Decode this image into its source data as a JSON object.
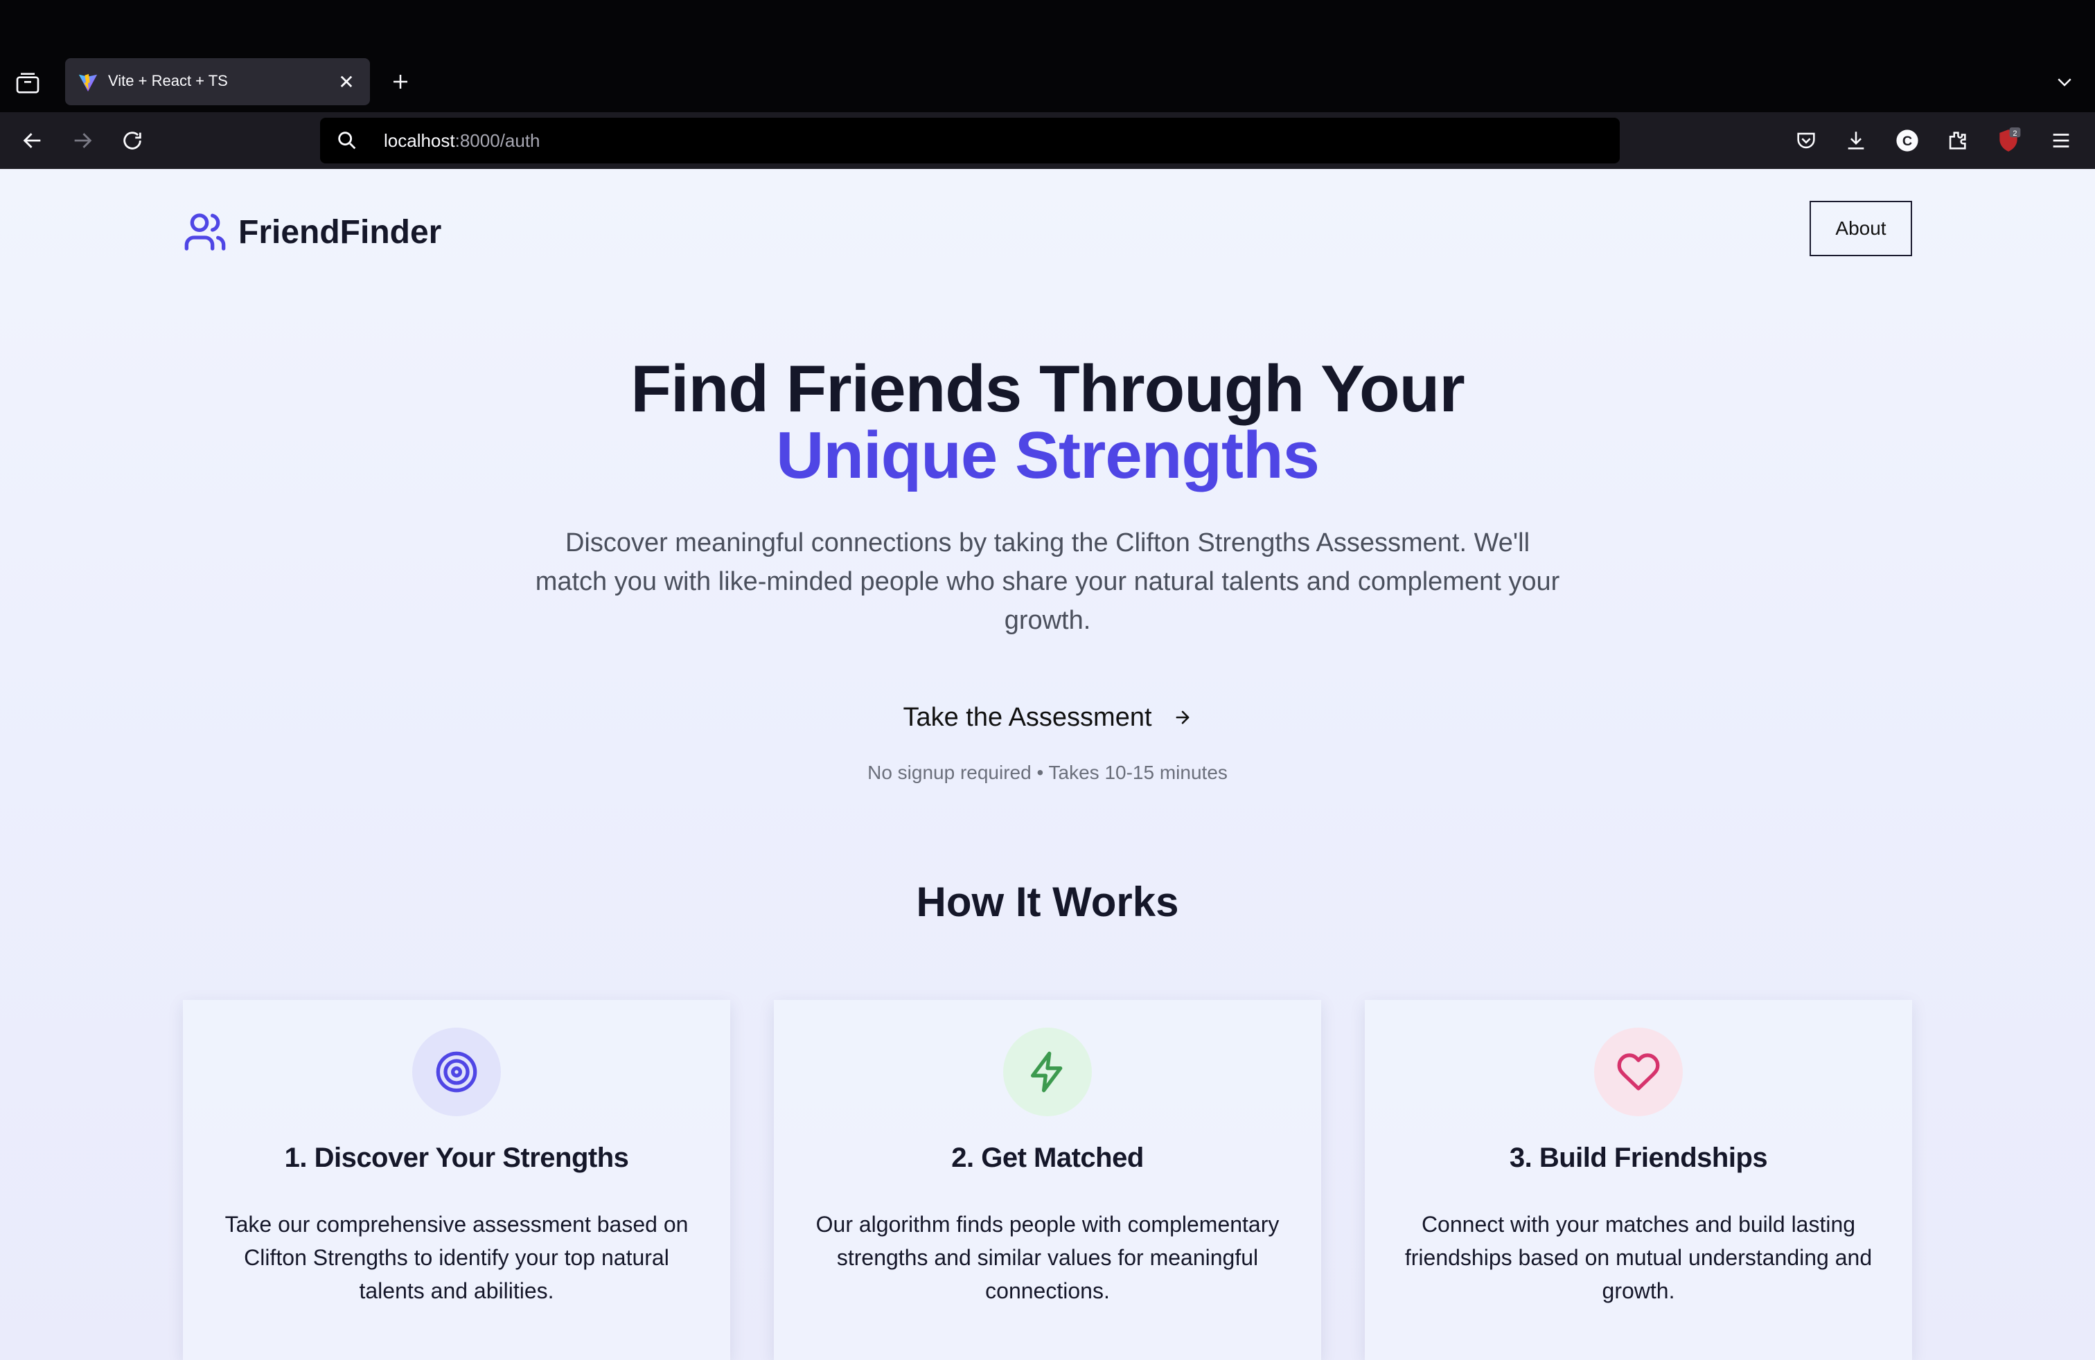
{
  "browser": {
    "tab_title": "Vite + React + TS",
    "url_host": "localhost",
    "url_path": ":8000/auth",
    "extension_badge": "2"
  },
  "header": {
    "brand": "FriendFinder",
    "about_label": "About"
  },
  "hero": {
    "title_line1": "Find Friends Through Your",
    "title_line2": "Unique Strengths",
    "description": "Discover meaningful connections by taking the Clifton Strengths Assessment. We'll match you with like-minded people who share your natural talents and complement your growth.",
    "cta_label": "Take the Assessment",
    "note": "No signup required • Takes 10-15 minutes"
  },
  "how": {
    "title": "How It Works",
    "cards": [
      {
        "icon": "target-icon",
        "title": "1. Discover Your Strengths",
        "description": "Take our comprehensive assessment based on Clifton Strengths to identify your top natural talents and abilities."
      },
      {
        "icon": "lightning-icon",
        "title": "2. Get Matched",
        "description": "Our algorithm finds people with complementary strengths and similar values for meaningful connections."
      },
      {
        "icon": "heart-icon",
        "title": "3. Build Friendships",
        "description": "Connect with your matches and build lasting friendships based on mutual understanding and growth."
      }
    ]
  },
  "colors": {
    "accent": "#4f46e5",
    "green": "#3d9a4f",
    "pink": "#d6336c"
  }
}
